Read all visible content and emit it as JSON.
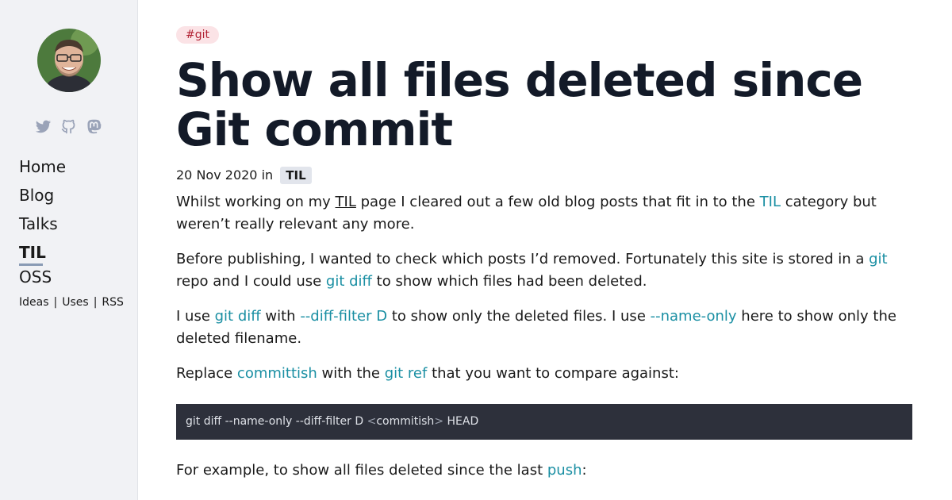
{
  "sidebar": {
    "avatar_alt": "Profile photo",
    "social": [
      {
        "icon": "twitter-icon"
      },
      {
        "icon": "github-icon"
      },
      {
        "icon": "mastodon-icon"
      }
    ],
    "nav": [
      {
        "label": "Home"
      },
      {
        "label": "Blog"
      },
      {
        "label": "Talks"
      },
      {
        "label": "TIL",
        "active": true
      },
      {
        "label": "OSS"
      }
    ],
    "meta_links": [
      "Ideas",
      "Uses",
      "RSS"
    ],
    "meta_separator": "|"
  },
  "article": {
    "tag": "#git",
    "title": "Show all files deleted since Git commit",
    "date": "20 Nov 2020",
    "in_word": "in",
    "category": "TIL",
    "p1": {
      "t1": "Whilst working on my ",
      "l1": "TIL",
      "t2": " page I cleared out a few old blog posts that fit in to the ",
      "l2": "TIL",
      "t3": " category but weren’t really relevant any more."
    },
    "p2": {
      "t1": "Before publishing, I wanted to check which posts I’d removed. Fortunately this site is stored in a ",
      "l1": "git",
      "t2": " repo and I could use ",
      "l2": "git diff",
      "t3": " to show which files had been deleted."
    },
    "p3": {
      "t1": "I use ",
      "l1": "git diff",
      "t2": " with ",
      "l2": "--diff-filter D",
      "t3": " to show only the deleted files. I use ",
      "l3": "--name-only",
      "t4": " here to show only the deleted filename."
    },
    "p4": {
      "t1": "Replace ",
      "l1": "committish",
      "t2": " with the ",
      "l2": "git ref",
      "t3": " that you want to compare against:"
    },
    "code": {
      "c1": "git diff --name-only --diff-filter D ",
      "c2": "<",
      "c3": "commitish",
      "c4": ">",
      "c5": " HEAD"
    },
    "p5": {
      "t1": "For example, to show all files deleted since the last ",
      "l1": "push",
      "t2": ":"
    }
  },
  "colors": {
    "link": "#1a8fa3",
    "tag_bg": "#fbe3e6",
    "tag_text": "#b11f31",
    "title": "#131a28",
    "code_bg": "#2d303b",
    "sidebar_bg": "#f1f2f5"
  }
}
